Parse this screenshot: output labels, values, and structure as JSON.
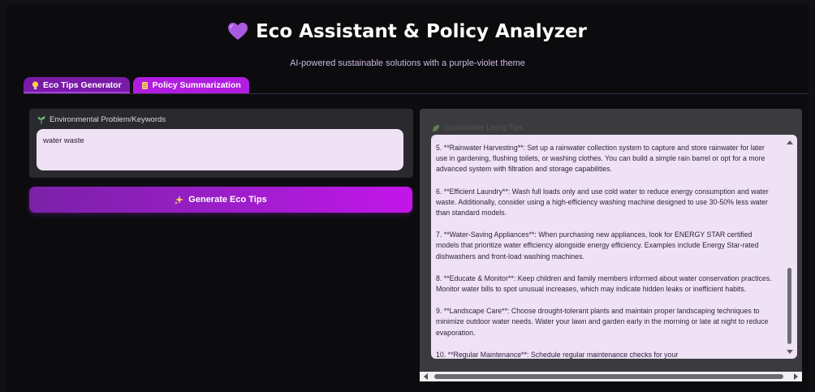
{
  "header": {
    "title": "Eco Assistant & Policy Analyzer",
    "subtitle": "AI-powered sustainable solutions with a purple-violet theme",
    "title_icon": "purple-heart-icon"
  },
  "tabs": [
    {
      "label": "Eco Tips Generator",
      "icon": "lightbulb-icon",
      "active": true
    },
    {
      "label": "Policy Summarization",
      "icon": "scroll-icon",
      "active": false
    }
  ],
  "input": {
    "label": "Environmental Problem/Keywords",
    "label_icon": "seedling-icon",
    "value": "water waste"
  },
  "generate_button": {
    "label": "Generate Eco Tips",
    "icon": "sparkles-icon"
  },
  "output": {
    "label": "Sustainable Living Tips",
    "label_icon": "leaf-icon",
    "paragraphs": [
      "5. **Rainwater Harvesting**: Set up a rainwater collection system to capture and store rainwater for later use in gardening, flushing toilets, or washing clothes. You can build a simple rain barrel or opt for a more advanced system with filtration and storage capabilities.",
      "6. **Efficient Laundry**: Wash full loads only and use cold water to reduce energy consumption and water waste. Additionally, consider using a high-efficiency washing machine designed to use 30-50% less water than standard models.",
      "7. **Water-Saving Appliances**: When purchasing new appliances, look for ENERGY STAR certified models that prioritize water efficiency alongside energy efficiency. Examples include Energy Star-rated dishwashers and front-load washing machines.",
      "8. **Educate & Monitor**: Keep children and family members informed about water conservation practices. Monitor water bills to spot unusual increases, which may indicate hidden leaks or inefficient habits.",
      "9. **Landscape Care**: Choose drought-tolerant plants and maintain proper landscaping techniques to minimize outdoor water needs. Water your lawn and garden early in the morning or late at night to reduce evaporation.",
      "10. **Regular Maintenance**: Schedule regular maintenance checks for your"
    ]
  },
  "colors": {
    "background": "#0c0c0f",
    "accent": "#b11de0",
    "active_tab": "#7a1aa8",
    "textbox": "#efe2f5"
  }
}
